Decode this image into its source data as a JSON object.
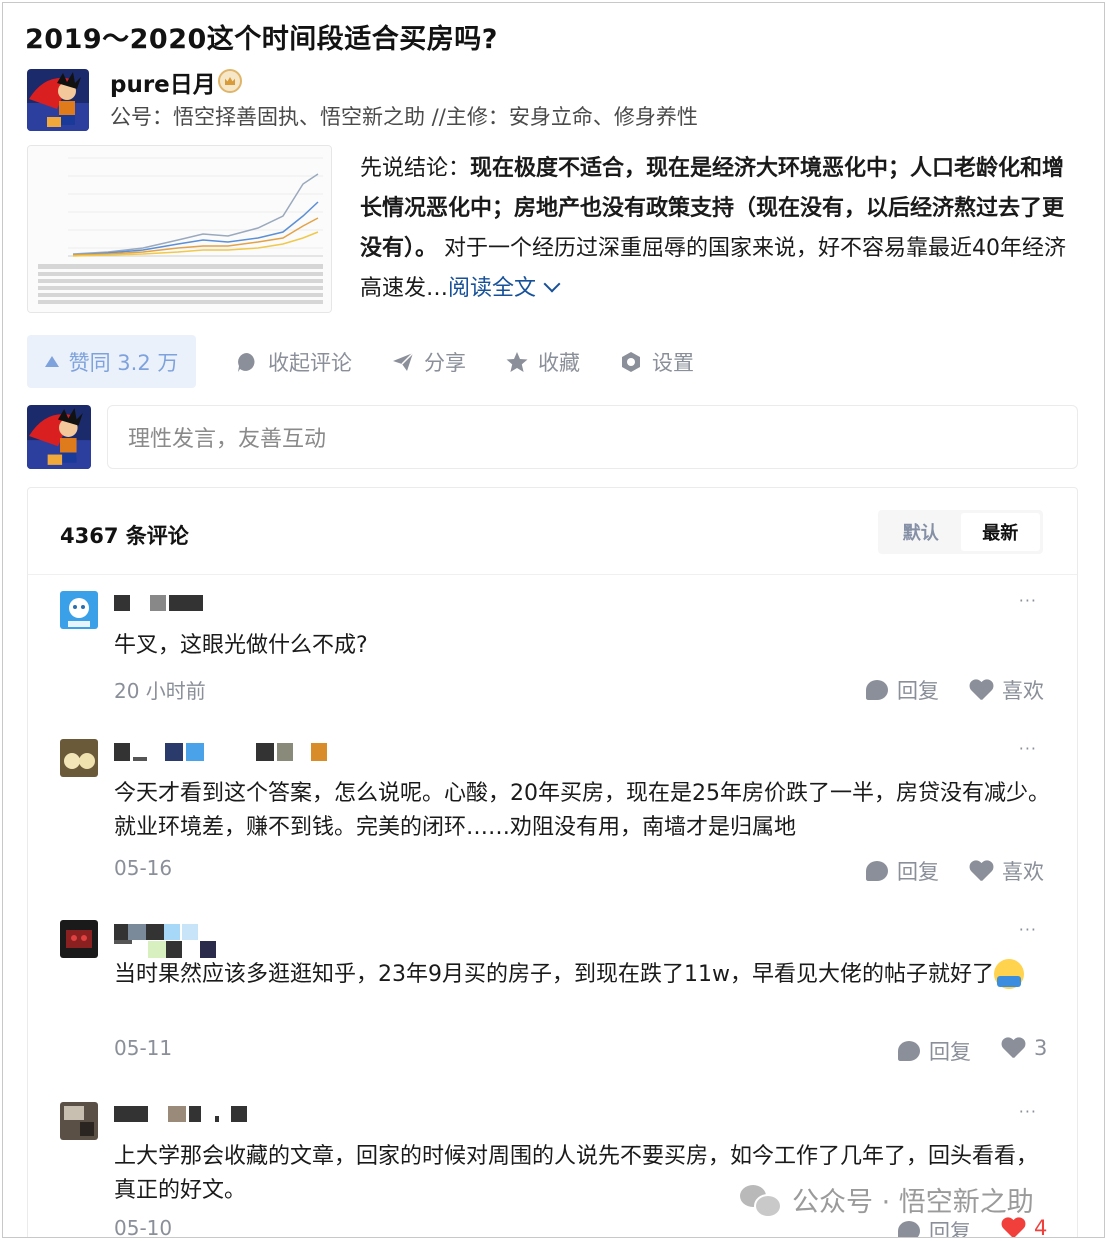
{
  "question": {
    "title": "2019～2020这个时间段适合买房吗?"
  },
  "author": {
    "name": "pure日月",
    "bio": "公号：悟空择善固执、悟空新之助 //主修：安身立命、修身养性"
  },
  "answer": {
    "excerpt_lead": "先说结论：",
    "excerpt_bold": "现在极度不适合，现在是经济大环境恶化中；人口老龄化和增长情况恶化中；房地产也没有政策支持（现在没有，以后经济熬过去了更没有）。",
    "excerpt_rest": " 对于一个经历过深重屈辱的国家来说，好不容易靠最近40年经济高速发…",
    "read_more": "阅读全文"
  },
  "actions": {
    "vote": "赞同 3.2 万",
    "collapse_comments": "收起评论",
    "share": "分享",
    "favorite": "收藏",
    "settings": "设置"
  },
  "comment_input": {
    "placeholder": "理性发言，友善互动"
  },
  "comments_header": {
    "count": "4367 条评论",
    "sort_default": "默认",
    "sort_latest": "最新"
  },
  "comments": [
    {
      "text": "牛叉，这眼光做什么不成?",
      "time": "20 小时前",
      "reply": "回复",
      "like": "喜欢"
    },
    {
      "text": "今天才看到这个答案，怎么说呢。心酸，20年买房，现在是25年房价跌了一半，房贷没有减少。就业环境差，赚不到钱。完美的闭环……劝阻没有用，南墙才是归属地",
      "time": "05-16",
      "reply": "回复",
      "like": "喜欢"
    },
    {
      "text": "当时果然应该多逛逛知乎，23年9月买的房子，到现在跌了11w，早看见大佬的帖子就好了",
      "time": "05-11",
      "reply": "回复",
      "like": "3"
    },
    {
      "text": "上大学那会收藏的文章，回家的时候对周围的人说先不要买房，如今工作了几年了，回头看看，真正的好文。",
      "time": "05-10",
      "reply": "回复",
      "like": "4"
    }
  ],
  "more_label": "···",
  "watermark": "公众号 · 悟空新之助",
  "colors": {
    "link": "#175199",
    "vote_bg": "#ebf1fb",
    "vote_text": "#7ea3dc",
    "like_active": "#f1403c"
  }
}
